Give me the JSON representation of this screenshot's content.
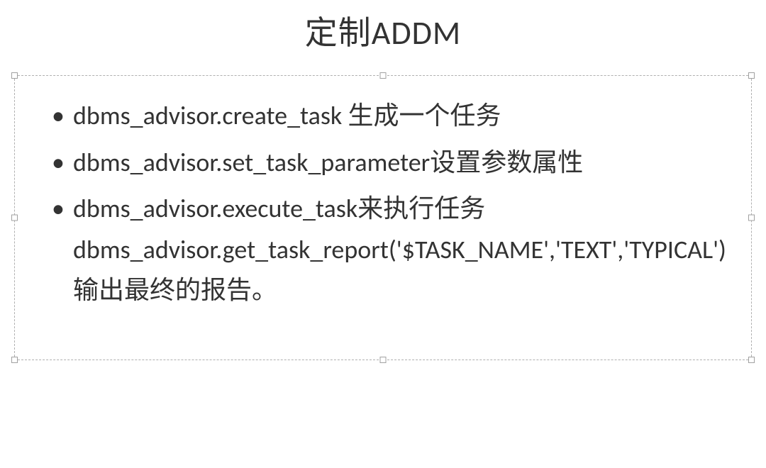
{
  "slide": {
    "title": "定制ADDM",
    "bullets": [
      "dbms_advisor.create_task 生成一个任务",
      "dbms_advisor.set_task_parameter设置参数属性",
      "dbms_advisor.execute_task来执行任务dbms_advisor.get_task_report('$TASK_NAME','TEXT','TYPICAL') 输出最终的报告。"
    ]
  }
}
